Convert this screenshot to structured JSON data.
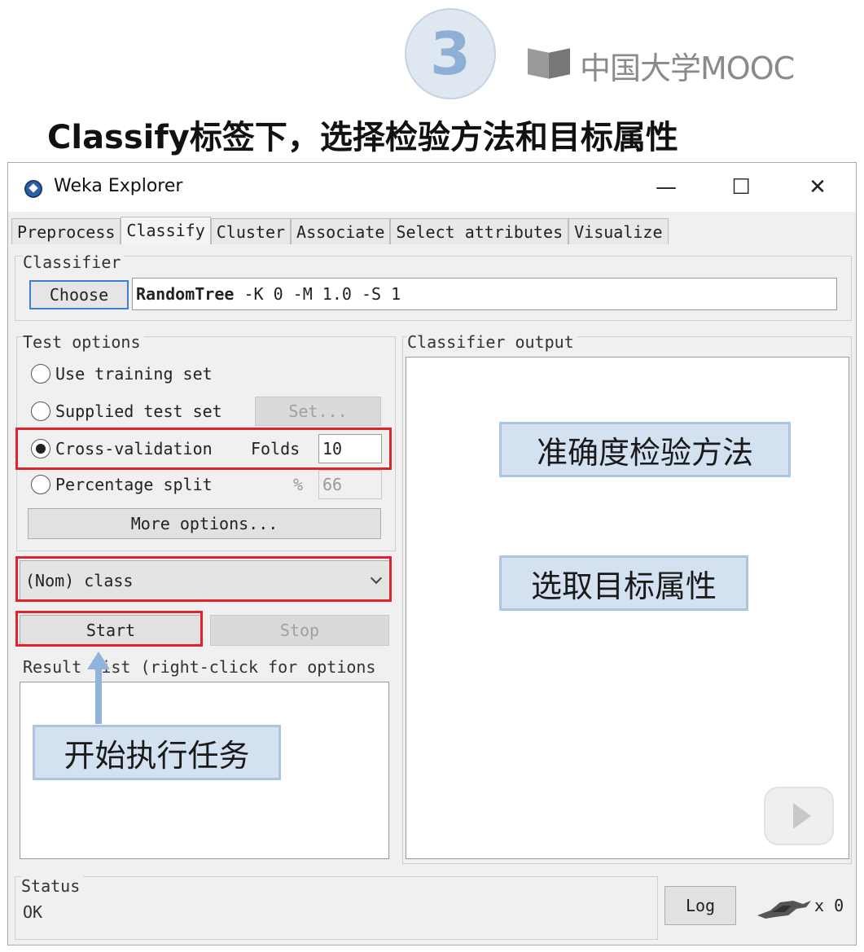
{
  "slide": {
    "step_number": "3",
    "brand": "中国大学MOOC",
    "title": "Classify标签下，选择检验方法和目标属性"
  },
  "window": {
    "title": "Weka Explorer",
    "controls": {
      "minimize": "—",
      "maximize": "☐",
      "close": "✕"
    }
  },
  "tabs": [
    {
      "label": "Preprocess",
      "active": false
    },
    {
      "label": "Classify",
      "active": true
    },
    {
      "label": "Cluster",
      "active": false
    },
    {
      "label": "Associate",
      "active": false
    },
    {
      "label": "Select attributes",
      "active": false
    },
    {
      "label": "Visualize",
      "active": false
    }
  ],
  "classifier": {
    "group_label": "Classifier",
    "choose_label": "Choose",
    "name": "RandomTree",
    "options": " -K 0 -M 1.0 -S 1"
  },
  "test_options": {
    "group_label": "Test options",
    "use_training_set": "Use training set",
    "supplied_test_set": "Supplied test set",
    "set_button": "Set...",
    "cross_validation": "Cross-validation",
    "folds_label": "Folds",
    "folds_value": "10",
    "percentage_split": "Percentage split",
    "percent_symbol": "%",
    "percent_value": "66",
    "more_options": "More options...",
    "selected": "cross_validation"
  },
  "class_attribute": {
    "value": "(Nom) class"
  },
  "actions": {
    "start": "Start",
    "stop": "Stop"
  },
  "result_list": {
    "label": "Result list (right-click for options"
  },
  "output": {
    "label": "Classifier output"
  },
  "status": {
    "label": "Status",
    "text": "OK",
    "log_button": "Log",
    "count": "x 0"
  },
  "annotations": {
    "accuracy_method": "准确度检验方法",
    "target_attribute": "选取目标属性",
    "start_task": "开始执行任务"
  },
  "colors": {
    "highlight": "#e0232d",
    "callout_bg": "#d3e1f1",
    "accent": "#3f7fd0"
  }
}
